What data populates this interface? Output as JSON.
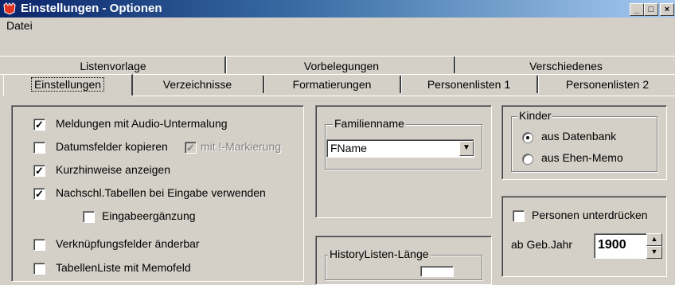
{
  "window": {
    "title": "Einstellungen - Optionen"
  },
  "titlebar_buttons": [
    "_",
    "□",
    "×"
  ],
  "menu": {
    "datei": "Datei"
  },
  "tabs_row1": [
    "Listenvorlage",
    "Vorbelegungen",
    "Verschiedenes"
  ],
  "tabs_row2": [
    "Einstellungen",
    "Verzeichnisse",
    "Formatierungen",
    "Personenlisten 1",
    "Personenlisten 2"
  ],
  "active_tab": "Einstellungen",
  "checkboxes": [
    {
      "label": "Meldungen mit Audio-Untermalung",
      "checked": true
    },
    {
      "label": "Datumsfelder kopieren",
      "checked": false
    },
    {
      "label": "mit !-Markierung",
      "checked": true,
      "disabled": true
    },
    {
      "label": "Kurzhinweise anzeigen",
      "checked": true
    },
    {
      "label": "Nachschl.Tabellen bei Eingabe verwenden",
      "checked": true
    },
    {
      "label": "Eingabeergänzung",
      "checked": false
    },
    {
      "label": "Verknüpfungsfelder änderbar",
      "checked": false
    },
    {
      "label": "TabellenListe mit Memofeld",
      "checked": false
    }
  ],
  "familienname": {
    "label": "Familienname",
    "value": "FName"
  },
  "history": {
    "label": "HistoryListen-Länge"
  },
  "kinder": {
    "label": "Kinder",
    "options": [
      {
        "label": "aus Datenbank",
        "selected": true
      },
      {
        "label": "aus Ehen-Memo",
        "selected": false
      }
    ]
  },
  "personen": {
    "checkbox_label": "Personen unterdrücken",
    "checked": false,
    "year_label": "ab Geb.Jahr",
    "year_value": "1900"
  }
}
